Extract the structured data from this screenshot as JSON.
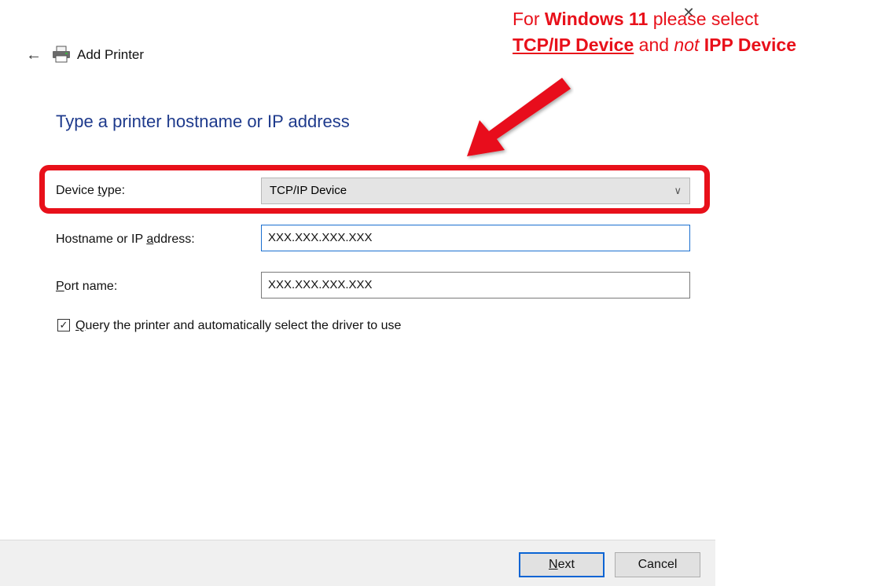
{
  "window": {
    "title": "Add Printer",
    "back_glyph": "←",
    "close_glyph": "✕"
  },
  "heading": "Type a printer hostname or IP address",
  "form": {
    "device_type": {
      "label_pre": "Device ",
      "label_accel": "t",
      "label_post": "ype:",
      "value": "TCP/IP Device"
    },
    "hostname": {
      "label_pre": "Hostname or IP ",
      "label_accel": "a",
      "label_post": "ddress:",
      "value": "XXX.XXX.XXX.XXX"
    },
    "port": {
      "label_accel": "P",
      "label_post": "ort name:",
      "value": "XXX.XXX.XXX.XXX"
    },
    "query_checkbox": {
      "checked": true,
      "check_glyph": "✓",
      "label_accel": "Q",
      "label_post": "uery the printer and automatically select the driver to use"
    }
  },
  "annotation": {
    "line1_pre": "For ",
    "line1_bold": "Windows 11",
    "line1_post": " please select",
    "line2_bold_underline": "TCP/IP Device",
    "line2_mid": " and ",
    "line2_italic": "not",
    "line2_bold": " IPP Device",
    "color": "#e8101a"
  },
  "footer": {
    "next_accel": "N",
    "next_post": "ext",
    "cancel_label": "Cancel"
  },
  "icons": {
    "back": "back-arrow-icon",
    "printer": "printer-icon",
    "close": "close-icon",
    "dropdown": "chevron-down-icon",
    "checkbox": "checkmark-icon"
  },
  "colors": {
    "heading": "#1e3a8c",
    "highlight": "#e8101a",
    "focus": "#1a6fd0"
  }
}
